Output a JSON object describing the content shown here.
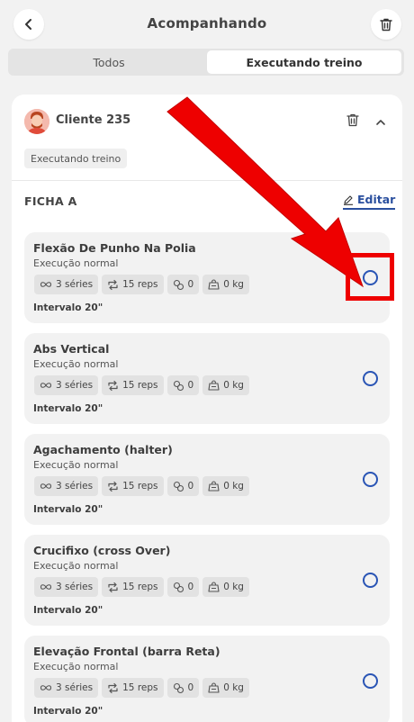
{
  "header": {
    "title": "Acompanhando"
  },
  "tabs": [
    {
      "label": "Todos",
      "active": false
    },
    {
      "label": "Executando treino",
      "active": true
    }
  ],
  "client": {
    "name": "Cliente 235",
    "status": "Executando treino"
  },
  "sheet": {
    "title": "FICHA A",
    "edit_label": "Editar"
  },
  "exercises": [
    {
      "name": "Flexão De Punho Na Polia",
      "mode": "Execução normal",
      "series": "3 séries",
      "reps": "15 reps",
      "rest_count": "0",
      "weight": "0 kg",
      "interval": "Intervalo 20\""
    },
    {
      "name": "Abs Vertical",
      "mode": "Execução normal",
      "series": "3 séries",
      "reps": "15 reps",
      "rest_count": "0",
      "weight": "0 kg",
      "interval": "Intervalo 20\""
    },
    {
      "name": "Agachamento (halter)",
      "mode": "Execução normal",
      "series": "3 séries",
      "reps": "15 reps",
      "rest_count": "0",
      "weight": "0 kg",
      "interval": "Intervalo 20\""
    },
    {
      "name": "Crucifixo (cross Over)",
      "mode": "Execução normal",
      "series": "3 séries",
      "reps": "15 reps",
      "rest_count": "0",
      "weight": "0 kg",
      "interval": "Intervalo 20\""
    },
    {
      "name": "Elevação Frontal (barra Reta)",
      "mode": "Execução normal",
      "series": "3 séries",
      "reps": "15 reps",
      "rest_count": "0",
      "weight": "0 kg",
      "interval": "Intervalo 20\""
    }
  ],
  "colors": {
    "accent": "#2a4f9e",
    "check": "#2a55b5",
    "annotation": "#ee0000"
  },
  "icons": [
    "chevron-left-icon",
    "trash-icon",
    "chevron-up-icon",
    "pencil-icon",
    "infinity-icon",
    "repeat-icon",
    "link-icon",
    "weight-icon",
    "check-circle-icon",
    "arrow-annotation"
  ]
}
